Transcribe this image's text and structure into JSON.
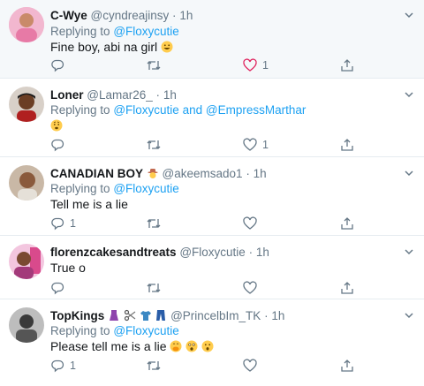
{
  "tweets": [
    {
      "name": "C-Wye",
      "handle": "@cyndreajinsy",
      "dot": "·",
      "time": "1h",
      "reply_prefix": "Replying to",
      "reply_to": "@Floxycutie",
      "text": "Fine boy, abi na girl",
      "counts": {
        "reply": "",
        "retweet": "",
        "like": "1"
      }
    },
    {
      "name": "Loner",
      "handle": "@Lamar26_",
      "dot": "·",
      "time": "1h",
      "reply_prefix": "Replying to",
      "reply_to": "@Floxycutie",
      "reply_joiner": "and",
      "reply_to_2": "@EmpressMarthar",
      "text": "",
      "counts": {
        "reply": "",
        "retweet": "",
        "like": "1"
      }
    },
    {
      "name": "CANADIAN BOY",
      "handle": "@akeemsado1",
      "dot": "·",
      "time": "1h",
      "reply_prefix": "Replying to",
      "reply_to": "@Floxycutie",
      "text": "Tell me is a lie",
      "counts": {
        "reply": "1",
        "retweet": "",
        "like": ""
      }
    },
    {
      "name": "florenzcakesandtreats",
      "handle": "@Floxycutie",
      "dot": "·",
      "time": "1h",
      "text": "True o",
      "counts": {
        "reply": "",
        "retweet": "",
        "like": ""
      }
    },
    {
      "name": "TopKings",
      "handle": "@PrincelbIm_TK",
      "dot": "·",
      "time": "1h",
      "reply_prefix": "Replying to",
      "reply_to": "@Floxycutie",
      "text": "Please tell me is a lie",
      "counts": {
        "reply": "1",
        "retweet": "",
        "like": ""
      }
    }
  ],
  "colors": {
    "accent": "#1da1f2",
    "muted": "#657786",
    "like_active": "#e0245e",
    "divider": "#e6ecf0"
  },
  "icons": [
    "reply-icon",
    "retweet-icon",
    "like-icon",
    "share-icon",
    "chevron-down-icon"
  ]
}
